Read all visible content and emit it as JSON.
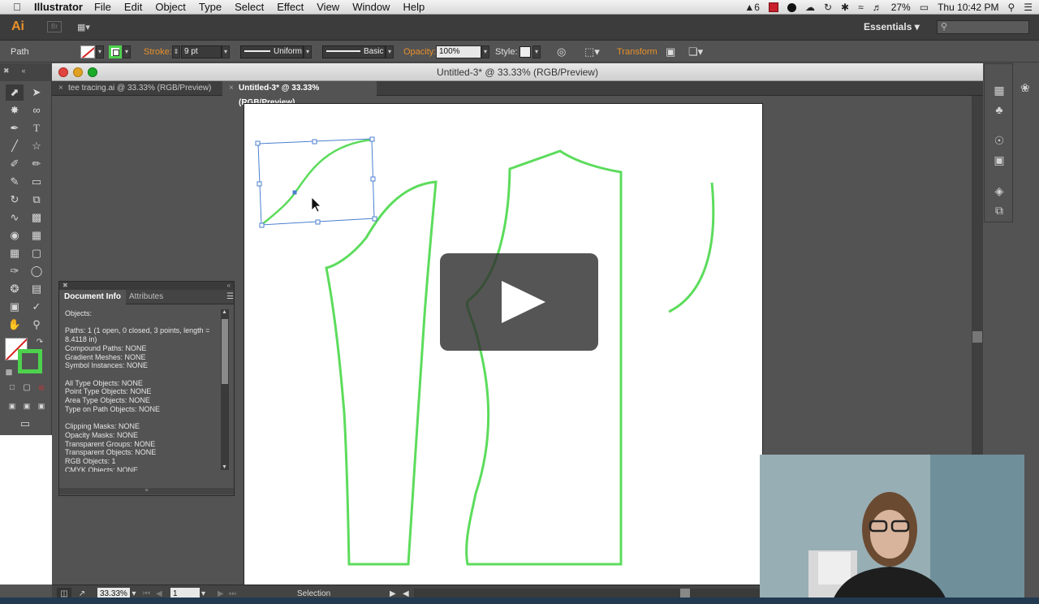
{
  "menubar": {
    "app_name": "Illustrator",
    "items": [
      "File",
      "Edit",
      "Object",
      "Type",
      "Select",
      "Effect",
      "View",
      "Window",
      "Help"
    ],
    "status": {
      "adobe_badge": "6",
      "battery": "27%",
      "clock": "Thu 10:42 PM"
    }
  },
  "appbar": {
    "logo": "Ai",
    "bridge": "Br",
    "workspace": "Essentials",
    "workspace_arrow": "▾"
  },
  "control_bar": {
    "selection_type": "Path",
    "stroke_label": "Stroke:",
    "stroke_weight": "9 pt",
    "profile_label": "Uniform",
    "brush_label": "Basic",
    "opacity_label": "Opacity:",
    "opacity_value": "100%",
    "style_label": "Style:",
    "transform_label": "Transform"
  },
  "window": {
    "title": "Untitled-3* @ 33.33% (RGB/Preview)",
    "tabs": [
      {
        "label": "tee tracing.ai @ 33.33% (RGB/Preview)",
        "active": false
      },
      {
        "label": "Untitled-3* @ 33.33% (RGB/Preview)",
        "active": true
      }
    ]
  },
  "status_bar": {
    "zoom": "33.33%",
    "artboard": "1",
    "tool": "Selection"
  },
  "doc_info": {
    "tabs": [
      "Document Info",
      "Attributes"
    ],
    "text": "Objects:\n\nPaths: 1 (1 open, 0 closed, 3 points, length = 8.4118 in)\nCompound Paths: NONE\nGradient Meshes: NONE\nSymbol Instances: NONE\n\nAll Type Objects: NONE\nPoint Type Objects: NONE\nArea Type Objects: NONE\nType on Path Objects: NONE\n\nClipping Masks: NONE\nOpacity Masks: NONE\nTransparent Groups: NONE\nTransparent Objects: NONE\nRGB Objects: 1\nCMYK Objects: NONE"
  },
  "colors": {
    "stroke_green": "#5cdc5c",
    "selection_blue": "#4a7fd0",
    "accent_orange": "#e8902a"
  },
  "icons": [
    "apple-icon",
    "search-icon",
    "wifi-icon",
    "volume-icon",
    "bluetooth-icon",
    "play-icon"
  ]
}
